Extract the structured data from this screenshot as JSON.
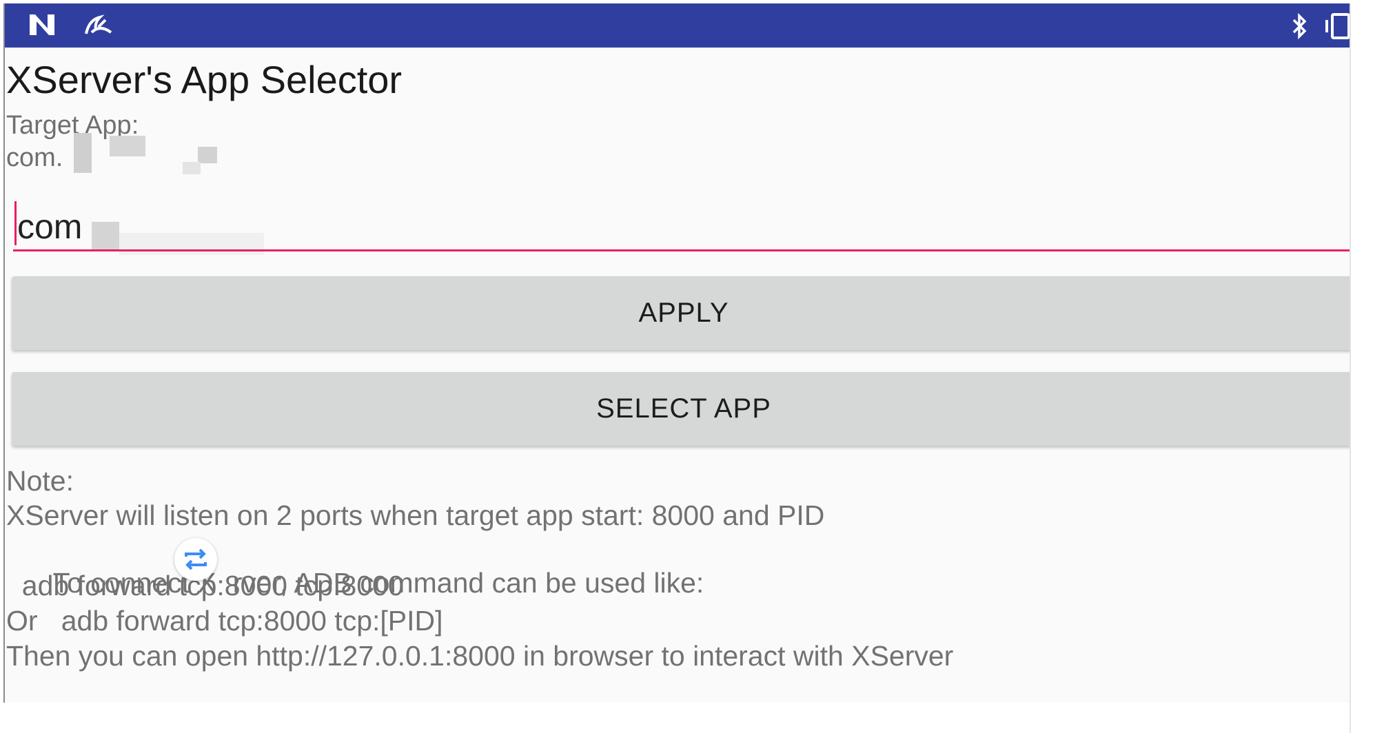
{
  "statusbar": {
    "left_icons": [
      "n-notification-icon",
      "incognito-icon"
    ],
    "right_icons": [
      "bluetooth-icon",
      "vibrate-icon"
    ],
    "color": "#303f9f"
  },
  "app": {
    "title": "XServer's App Selector",
    "target_label": "Target App:",
    "target_value": "com.",
    "input_value": "com",
    "accent_color": "#e91e63"
  },
  "buttons": {
    "apply": "APPLY",
    "select_app": "SELECT APP"
  },
  "note": {
    "lines": [
      "Note:",
      "XServer will listen on 2 ports when target app start: 8000 and PID",
      "To connect X",
      "rver, ADB command can be used like:",
      "  adb forward tcp:8000 tcp:8000",
      "Or   adb forward tcp:8000 tcp:[PID]",
      "Then you can open http://127.0.0.1:8000 in browser to interact with XServer"
    ]
  }
}
